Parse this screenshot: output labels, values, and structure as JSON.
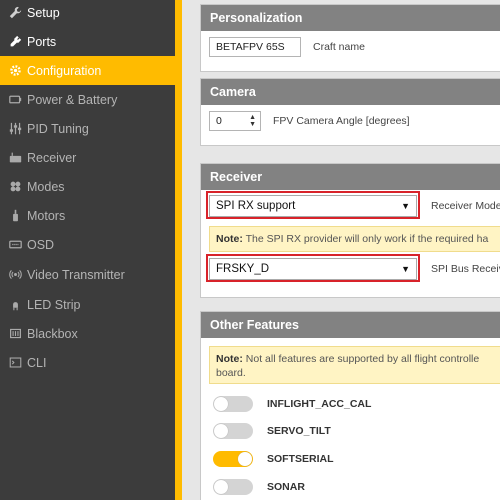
{
  "sidebar": {
    "items": [
      {
        "label": "Setup",
        "icon": "wrench-icon"
      },
      {
        "label": "Ports",
        "icon": "plug-icon"
      },
      {
        "label": "Configuration",
        "icon": "gear-icon"
      },
      {
        "label": "Power & Battery",
        "icon": "battery-icon"
      },
      {
        "label": "PID Tuning",
        "icon": "sliders-icon"
      },
      {
        "label": "Receiver",
        "icon": "receiver-icon"
      },
      {
        "label": "Modes",
        "icon": "modes-icon"
      },
      {
        "label": "Motors",
        "icon": "motor-icon"
      },
      {
        "label": "OSD",
        "icon": "osd-icon"
      },
      {
        "label": "Video Transmitter",
        "icon": "broadcast-icon"
      },
      {
        "label": "LED Strip",
        "icon": "led-icon"
      },
      {
        "label": "Blackbox",
        "icon": "blackbox-icon"
      },
      {
        "label": "CLI",
        "icon": "terminal-icon"
      }
    ],
    "active_index": 2,
    "accent": "#ffbb00"
  },
  "personalization": {
    "title": "Personalization",
    "craft_name_value": "BETAFPV 65S",
    "craft_name_label": "Craft name"
  },
  "camera": {
    "title": "Camera",
    "angle_value": "0",
    "angle_label": "FPV Camera Angle [degrees]"
  },
  "receiver": {
    "title": "Receiver",
    "mode_value": "SPI RX support",
    "mode_label": "Receiver Mode",
    "note_bold": "Note:",
    "note_text": "The SPI RX provider will only work if the required ha",
    "provider_value": "FRSKY_D",
    "provider_label": "SPI Bus Receiver"
  },
  "other_features": {
    "title": "Other Features",
    "note_bold": "Note:",
    "note_text": "Not all features are supported by all flight controlle",
    "note_text_2": "board.",
    "features": [
      {
        "label": "INFLIGHT_ACC_CAL",
        "enabled": false
      },
      {
        "label": "SERVO_TILT",
        "enabled": false
      },
      {
        "label": "SOFTSERIAL",
        "enabled": true
      },
      {
        "label": "SONAR",
        "enabled": false
      }
    ]
  },
  "colors": {
    "highlight_border": "#d8232a",
    "toggle_on": "#ffbb00"
  }
}
